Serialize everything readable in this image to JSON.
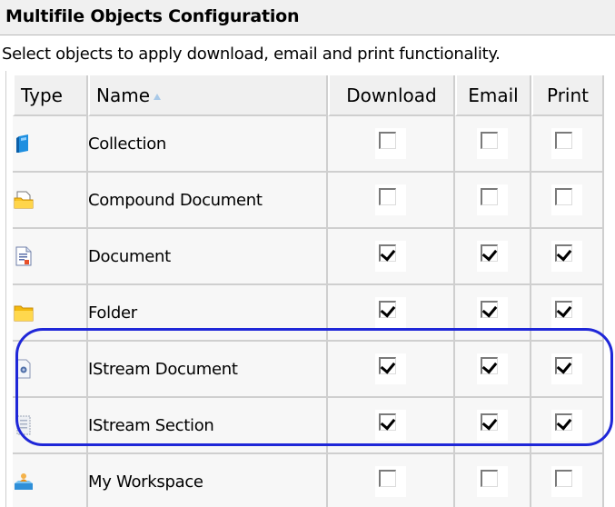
{
  "panel": {
    "title": "Multifile Objects Configuration",
    "subtitle": "Select objects to apply download, email and print functionality."
  },
  "table": {
    "columns": {
      "type": "Type",
      "name": "Name",
      "download": "Download",
      "email": "Email",
      "print": "Print"
    },
    "sort": {
      "column": "Name",
      "direction": "ascending"
    },
    "rows": [
      {
        "icon": "collection-icon",
        "name": "Collection",
        "download": false,
        "email": false,
        "print": false
      },
      {
        "icon": "compound-document-icon",
        "name": "Compound Document",
        "download": false,
        "email": false,
        "print": false
      },
      {
        "icon": "document-icon",
        "name": "Document",
        "download": true,
        "email": true,
        "print": true
      },
      {
        "icon": "folder-icon",
        "name": "Folder",
        "download": true,
        "email": true,
        "print": true
      },
      {
        "icon": "istream-document-icon",
        "name": "IStream Document",
        "download": true,
        "email": true,
        "print": true
      },
      {
        "icon": "istream-section-icon",
        "name": "IStream Section",
        "download": true,
        "email": true,
        "print": true
      },
      {
        "icon": "my-workspace-icon",
        "name": "My Workspace",
        "download": false,
        "email": false,
        "print": false
      }
    ]
  },
  "annotation": {
    "color": "#1f27d8",
    "highlighted_rows": [
      "IStream Document",
      "IStream Section"
    ]
  }
}
